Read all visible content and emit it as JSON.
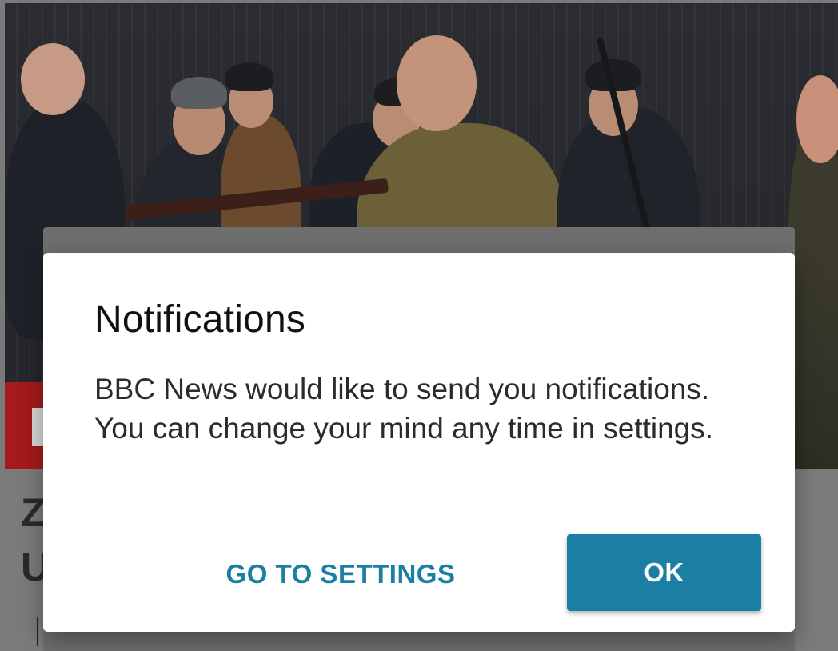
{
  "dialog": {
    "title": "Notifications",
    "message": "BBC News would like to send you notifications. You can change your mind any time in settings.",
    "secondary_button": "GO TO SETTINGS",
    "primary_button": "OK"
  },
  "background_article": {
    "headline_fragment_line1": "Z",
    "headline_fragment_line2": "U"
  },
  "colors": {
    "accent": "#1a7fa3",
    "dialog_background": "#ffffff",
    "scrim": "#7a7a7a",
    "brand_red": "#a51a1a"
  }
}
